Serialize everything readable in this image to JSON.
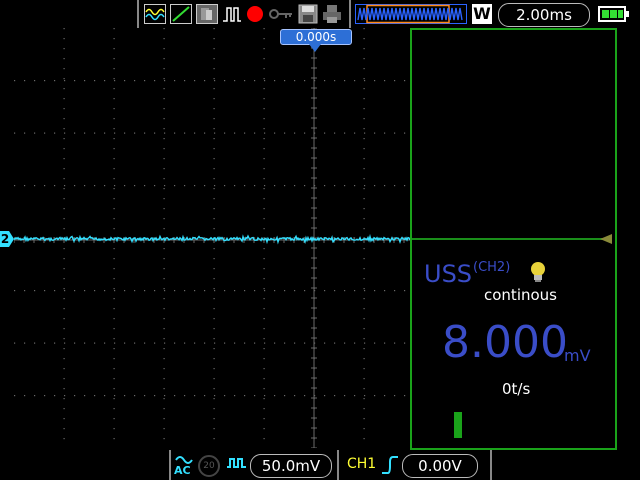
{
  "top_bar": {
    "timebase": "2.00ms",
    "timebase_mode_letter": "W",
    "icons": [
      "wave-mode-icon",
      "slope-icon",
      "persistence-icon",
      "pulse-icon",
      "record-icon",
      "key-icon",
      "save-icon",
      "print-icon",
      "waveform-window-icon"
    ],
    "record_color": "#ff0000"
  },
  "trigger_marker": {
    "time_offset": "0.000s"
  },
  "channel": {
    "marker": "2",
    "trace_color": "#33e0ff"
  },
  "measurement": {
    "name": "USS",
    "channel": "(CH2)",
    "mode": "continous",
    "value": "8.000",
    "unit": "mV",
    "rate": "0t/s",
    "accent_color": "#3a4dc8"
  },
  "bottom_bar": {
    "coupling": "AC",
    "bandwidth_limit": "20",
    "volts_per_div": "50.0mV",
    "trigger_source": "CH1",
    "trigger_level": "0.00V"
  }
}
